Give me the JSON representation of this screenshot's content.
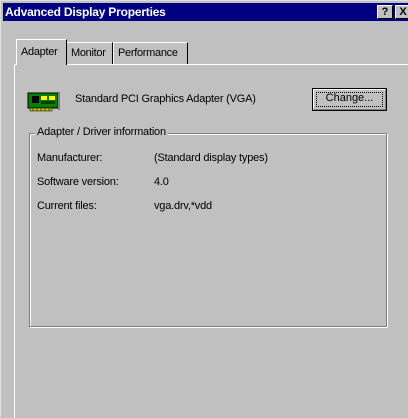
{
  "window": {
    "title": "Advanced Display Properties",
    "help_label": "?",
    "close_label": "X"
  },
  "tabs": [
    {
      "label": "Adapter",
      "active": true
    },
    {
      "label": "Monitor",
      "active": false
    },
    {
      "label": "Performance",
      "active": false
    }
  ],
  "adapter": {
    "icon": "graphics-card-icon",
    "name": "Standard PCI Graphics Adapter (VGA)",
    "change_button_label": "Change..."
  },
  "driver_info": {
    "group_title": "Adapter / Driver information",
    "rows": [
      {
        "label": "Manufacturer:",
        "value": "(Standard display types)"
      },
      {
        "label": "Software version:",
        "value": "4.0"
      },
      {
        "label": "Current files:",
        "value": "vga.drv,*vdd"
      }
    ]
  },
  "colors": {
    "titlebar": "#000080",
    "face": "#c0c0c0",
    "chip": "#008000"
  }
}
